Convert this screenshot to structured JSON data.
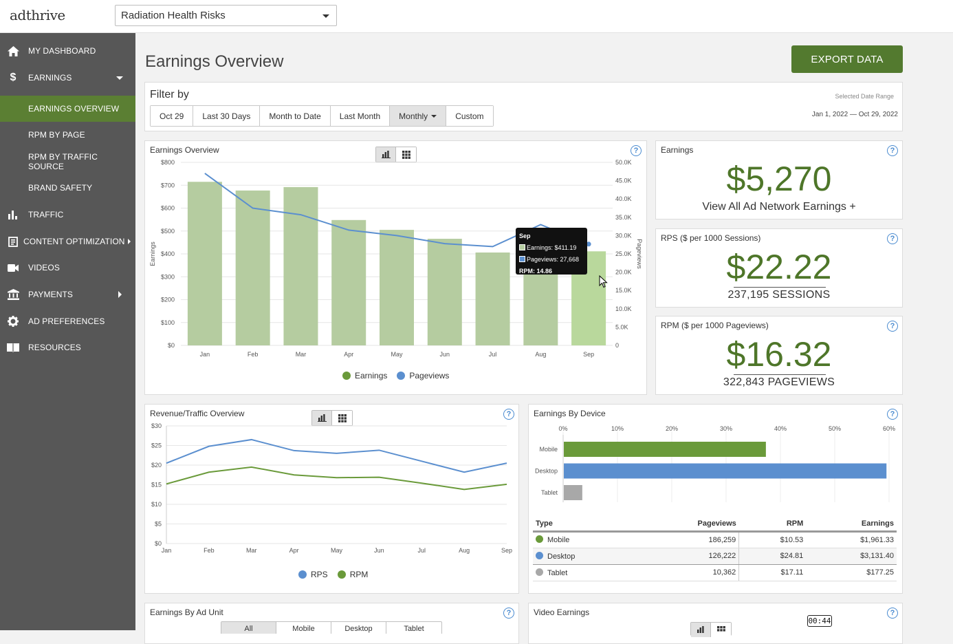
{
  "app": {
    "logo_text": "adthrive",
    "site_select": "Radiation Health Risks"
  },
  "sidebar": {
    "items": [
      {
        "label": "MY DASHBOARD",
        "icon": "home-icon"
      },
      {
        "label": "EARNINGS",
        "icon": "dollar-icon"
      },
      {
        "label": "EARNINGS OVERVIEW"
      },
      {
        "label": "RPM BY PAGE"
      },
      {
        "label": "RPM BY TRAFFIC SOURCE"
      },
      {
        "label": "BRAND SAFETY"
      },
      {
        "label": "TRAFFIC",
        "icon": "bar-chart-icon"
      },
      {
        "label": "CONTENT OPTIMIZATION",
        "icon": "content-icon"
      },
      {
        "label": "VIDEOS",
        "icon": "video-icon"
      },
      {
        "label": "PAYMENTS",
        "icon": "bank-icon"
      },
      {
        "label": "AD PREFERENCES",
        "icon": "gear-icon"
      },
      {
        "label": "RESOURCES",
        "icon": "book-icon"
      }
    ]
  },
  "header": {
    "title": "Earnings Overview",
    "export_label": "EXPORT DATA"
  },
  "filter": {
    "title": "Filter by",
    "buttons": [
      "Oct 29",
      "Last 30 Days",
      "Month to Date",
      "Last Month",
      "Monthly",
      "Custom"
    ],
    "active": "Monthly",
    "date_range_label": "Selected Date Range",
    "date_range_value": "Jan 1, 2022 — Oct 29, 2022"
  },
  "earnings_overview": {
    "title": "Earnings Overview",
    "legend": [
      "Earnings",
      "Pageviews"
    ],
    "tooltip": {
      "month": "Sep",
      "earnings": "Earnings: $411.19",
      "pageviews": "Pageviews: 27,668",
      "rpm": "RPM: 14.86"
    }
  },
  "cards": {
    "earnings": {
      "title": "Earnings",
      "value": "$5,270",
      "link": "View All Ad Network Earnings +"
    },
    "rps": {
      "title": "RPS ($ per 1000 Sessions)",
      "value": "$22.22",
      "sub": "237,195 SESSIONS"
    },
    "rpm": {
      "title": "RPM ($ per 1000 Pageviews)",
      "value": "$16.32",
      "sub": "322,843 PAGEVIEWS"
    }
  },
  "revenue_traffic": {
    "title": "Revenue/Traffic Overview",
    "legend": [
      "RPS",
      "RPM"
    ]
  },
  "device": {
    "title": "Earnings By Device",
    "headers": [
      "Type",
      "Pageviews",
      "RPM",
      "Earnings"
    ],
    "rows": [
      {
        "type": "Mobile",
        "pageviews": "186,259",
        "rpm": "$10.53",
        "earnings": "$1,961.33",
        "color": "#6a9a3a"
      },
      {
        "type": "Desktop",
        "pageviews": "126,222",
        "rpm": "$24.81",
        "earnings": "$3,131.40",
        "color": "#5b8fcf"
      },
      {
        "type": "Tablet",
        "pageviews": "10,362",
        "rpm": "$17.11",
        "earnings": "$177.25",
        "color": "#a8a8a8"
      }
    ]
  },
  "ad_unit": {
    "title": "Earnings By Ad Unit",
    "tabs": [
      "All",
      "Mobile",
      "Desktop",
      "Tablet"
    ]
  },
  "video": {
    "title": "Video Earnings",
    "timer": "00:44"
  },
  "chart_data": [
    {
      "type": "bar",
      "title": "Earnings Overview",
      "categories": [
        "Jan",
        "Feb",
        "Mar",
        "Apr",
        "May",
        "Jun",
        "Jul",
        "Aug",
        "Sep"
      ],
      "series": [
        {
          "name": "Earnings",
          "axis": "left",
          "type": "bar",
          "values": [
            715,
            677,
            692,
            548,
            505,
            466,
            406,
            405,
            411.19
          ],
          "color": "#b5cca0"
        },
        {
          "name": "Pageviews",
          "axis": "right",
          "type": "line",
          "values": [
            47000,
            37500,
            35700,
            31500,
            30000,
            27800,
            27000,
            33000,
            27668
          ],
          "color": "#5b8fcf"
        }
      ],
      "ylabel": "Earnings",
      "y2label": "Pageviews",
      "ylim": [
        0,
        800
      ],
      "yticks": [
        "$0",
        "$100",
        "$200",
        "$300",
        "$400",
        "$500",
        "$600",
        "$700",
        "$800"
      ],
      "y2lim": [
        0,
        50000
      ],
      "y2ticks": [
        "0",
        "5.0K",
        "10.0K",
        "15.0K",
        "20.0K",
        "25.0K",
        "30.0K",
        "35.0K",
        "40.0K",
        "45.0K",
        "50.0K"
      ],
      "grid": true
    },
    {
      "type": "line",
      "title": "Revenue/Traffic Overview",
      "categories": [
        "Jan",
        "Feb",
        "Mar",
        "Apr",
        "May",
        "Jun",
        "Jul",
        "Aug",
        "Sep"
      ],
      "series": [
        {
          "name": "RPS",
          "values": [
            20.5,
            24.8,
            26.5,
            23.7,
            23.0,
            23.8,
            21.0,
            18.2,
            20.5
          ],
          "color": "#5b8fcf"
        },
        {
          "name": "RPM",
          "values": [
            15.2,
            18.2,
            19.5,
            17.5,
            16.8,
            16.9,
            15.4,
            13.8,
            15.1
          ],
          "color": "#6a9a3a"
        }
      ],
      "ylim": [
        0,
        30
      ],
      "yticks": [
        "$0",
        "$5",
        "$10",
        "$15",
        "$20",
        "$25",
        "$30"
      ],
      "grid": true
    },
    {
      "type": "bar",
      "title": "Earnings By Device",
      "orientation": "horizontal",
      "categories": [
        "Mobile",
        "Desktop",
        "Tablet"
      ],
      "values": [
        37.2,
        59.4,
        3.4
      ],
      "colors": [
        "#6a9a3a",
        "#5b8fcf",
        "#a8a8a8"
      ],
      "xlim": [
        0,
        60
      ],
      "xticks": [
        "0%",
        "10%",
        "20%",
        "30%",
        "40%",
        "50%",
        "60%"
      ]
    }
  ]
}
